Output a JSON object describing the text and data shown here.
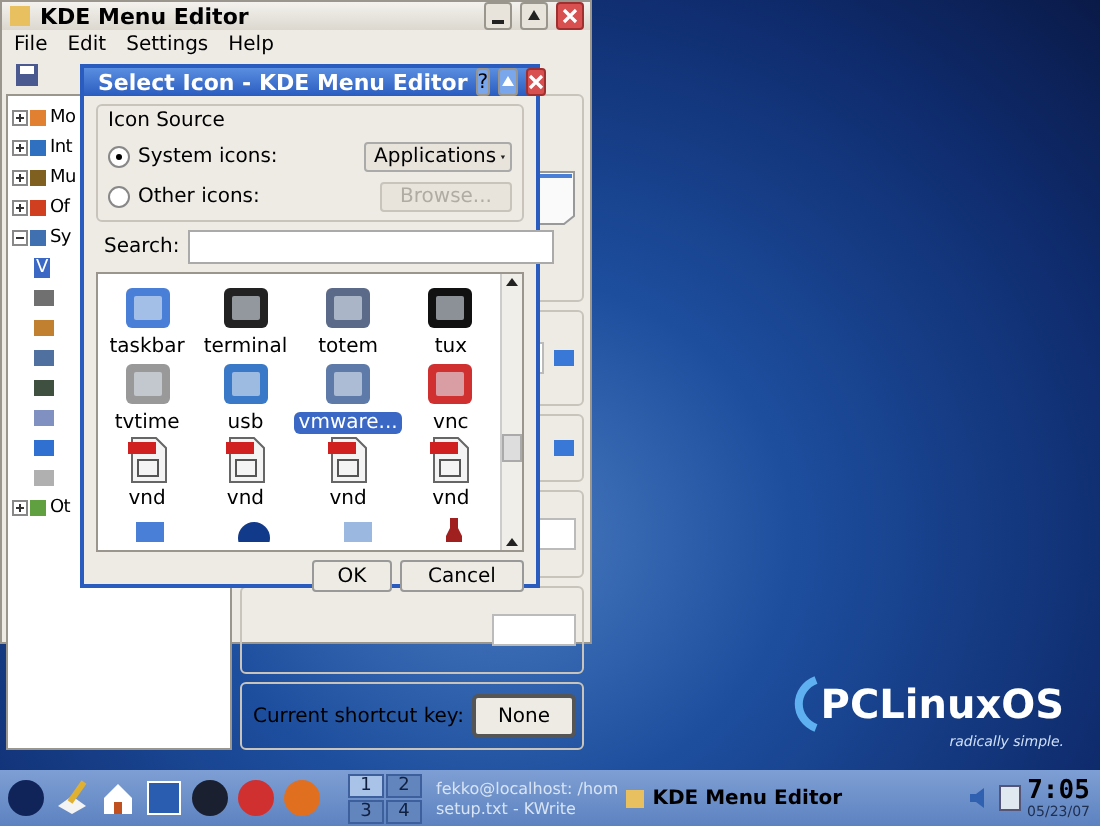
{
  "main_window": {
    "title": "KDE Menu Editor",
    "menu": [
      "File",
      "Edit",
      "Settings",
      "Help"
    ],
    "tree": [
      {
        "label": "Mo",
        "expanded": false
      },
      {
        "label": "Int",
        "expanded": false
      },
      {
        "label": "Mu",
        "expanded": false
      },
      {
        "label": "Of",
        "expanded": false
      },
      {
        "label": "Sy",
        "expanded": true,
        "children": [
          {
            "label": "V",
            "selected": true
          },
          {
            "selected": false
          },
          {
            "selected": false
          },
          {
            "selected": false
          },
          {
            "selected": false
          },
          {
            "selected": false
          },
          {
            "selected": false
          },
          {
            "selected": false
          }
        ]
      },
      {
        "label": "Ot",
        "expanded": false
      }
    ],
    "shortcut_label": "Current shortcut key:",
    "shortcut_button": "None"
  },
  "dialog": {
    "title": "Select Icon - KDE Menu Editor",
    "help_button": "?",
    "source_group": "Icon Source",
    "radios": [
      {
        "label": "System icons:",
        "selected": true
      },
      {
        "label": "Other icons:",
        "selected": false
      }
    ],
    "dropdown": "Applications",
    "browse": {
      "label": "Browse...",
      "disabled": true
    },
    "search_label": "Search:",
    "icons": [
      {
        "label": "taskbar",
        "kind": "app",
        "selected": false
      },
      {
        "label": "terminal",
        "kind": "app",
        "selected": false
      },
      {
        "label": "totem",
        "kind": "app",
        "selected": false
      },
      {
        "label": "tux",
        "kind": "app",
        "selected": false
      },
      {
        "label": "tvtime",
        "kind": "app",
        "selected": false
      },
      {
        "label": "usb",
        "kind": "app",
        "selected": false
      },
      {
        "label": "vmware...",
        "kind": "app",
        "selected": true
      },
      {
        "label": "vnc",
        "kind": "app",
        "selected": false
      },
      {
        "label": "vnd",
        "kind": "document",
        "selected": false
      },
      {
        "label": "vnd",
        "kind": "document",
        "selected": false
      },
      {
        "label": "vnd",
        "kind": "document",
        "selected": false
      },
      {
        "label": "vnd",
        "kind": "document",
        "selected": false
      }
    ],
    "buttons": [
      "OK",
      "Cancel"
    ]
  },
  "desktop_logo": {
    "name": "PCLinuxOS",
    "tagline": "radically simple."
  },
  "taskbar": {
    "pager": [
      {
        "label": "1",
        "selected": true
      },
      {
        "label": "2",
        "selected": false
      },
      {
        "label": "3",
        "selected": false
      },
      {
        "label": "4",
        "selected": false
      }
    ],
    "tasks": [
      {
        "label": "fekko@localhost: /hom",
        "active": false
      },
      {
        "label": "setup.txt - KWrite",
        "active": false
      },
      {
        "label": "KDE Menu Editor",
        "active": true
      }
    ],
    "clock": {
      "time": "7:05",
      "date": "05/23/07"
    }
  }
}
